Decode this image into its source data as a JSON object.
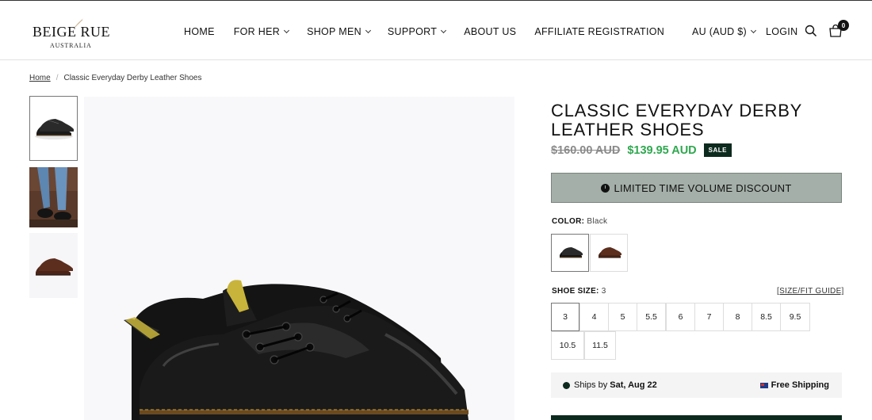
{
  "brand": {
    "name": "BEIGE RUE",
    "sub": "AUSTRALIA"
  },
  "nav": [
    {
      "label": "HOME"
    },
    {
      "label": "FOR HER"
    },
    {
      "label": "SHOP MEN"
    },
    {
      "label": "SUPPORT"
    },
    {
      "label": "ABOUT US"
    },
    {
      "label": "AFFILIATE REGISTRATION"
    }
  ],
  "header": {
    "currency": "AU (AUD $)",
    "login": "LOGIN",
    "cart_count": "0"
  },
  "breadcrumb": {
    "home": "Home",
    "separator": "/",
    "current": "Classic Everyday Derby Leather Shoes"
  },
  "product": {
    "title": "CLASSIC EVERYDAY DERBY LEATHER SHOES",
    "price_old": "$160.00 AUD",
    "price_new": "$139.95 AUD",
    "sale_badge": "SALE",
    "discount_label": "LIMITED TIME VOLUME DISCOUNT",
    "color_label": "COLOR:",
    "color_value": "Black",
    "colors": [
      "Black",
      "Brown"
    ],
    "size_label": "SHOE SIZE:",
    "size_value": "3",
    "size_guide": "[SIZE/FIT GUIDE]",
    "sizes": [
      "3",
      "4",
      "5",
      "5.5",
      "6",
      "7",
      "8",
      "8.5",
      "9.5",
      "10.5",
      "11.5"
    ],
    "selected_size": "3",
    "ships_prefix": "Ships by",
    "ships_date": "Sat, Aug 22",
    "free_shipping": "Free Shipping"
  },
  "colors": {
    "accent_green": "#2fa84f",
    "dark_green": "#0d2a1e",
    "discount_bg": "#a3afa8"
  }
}
